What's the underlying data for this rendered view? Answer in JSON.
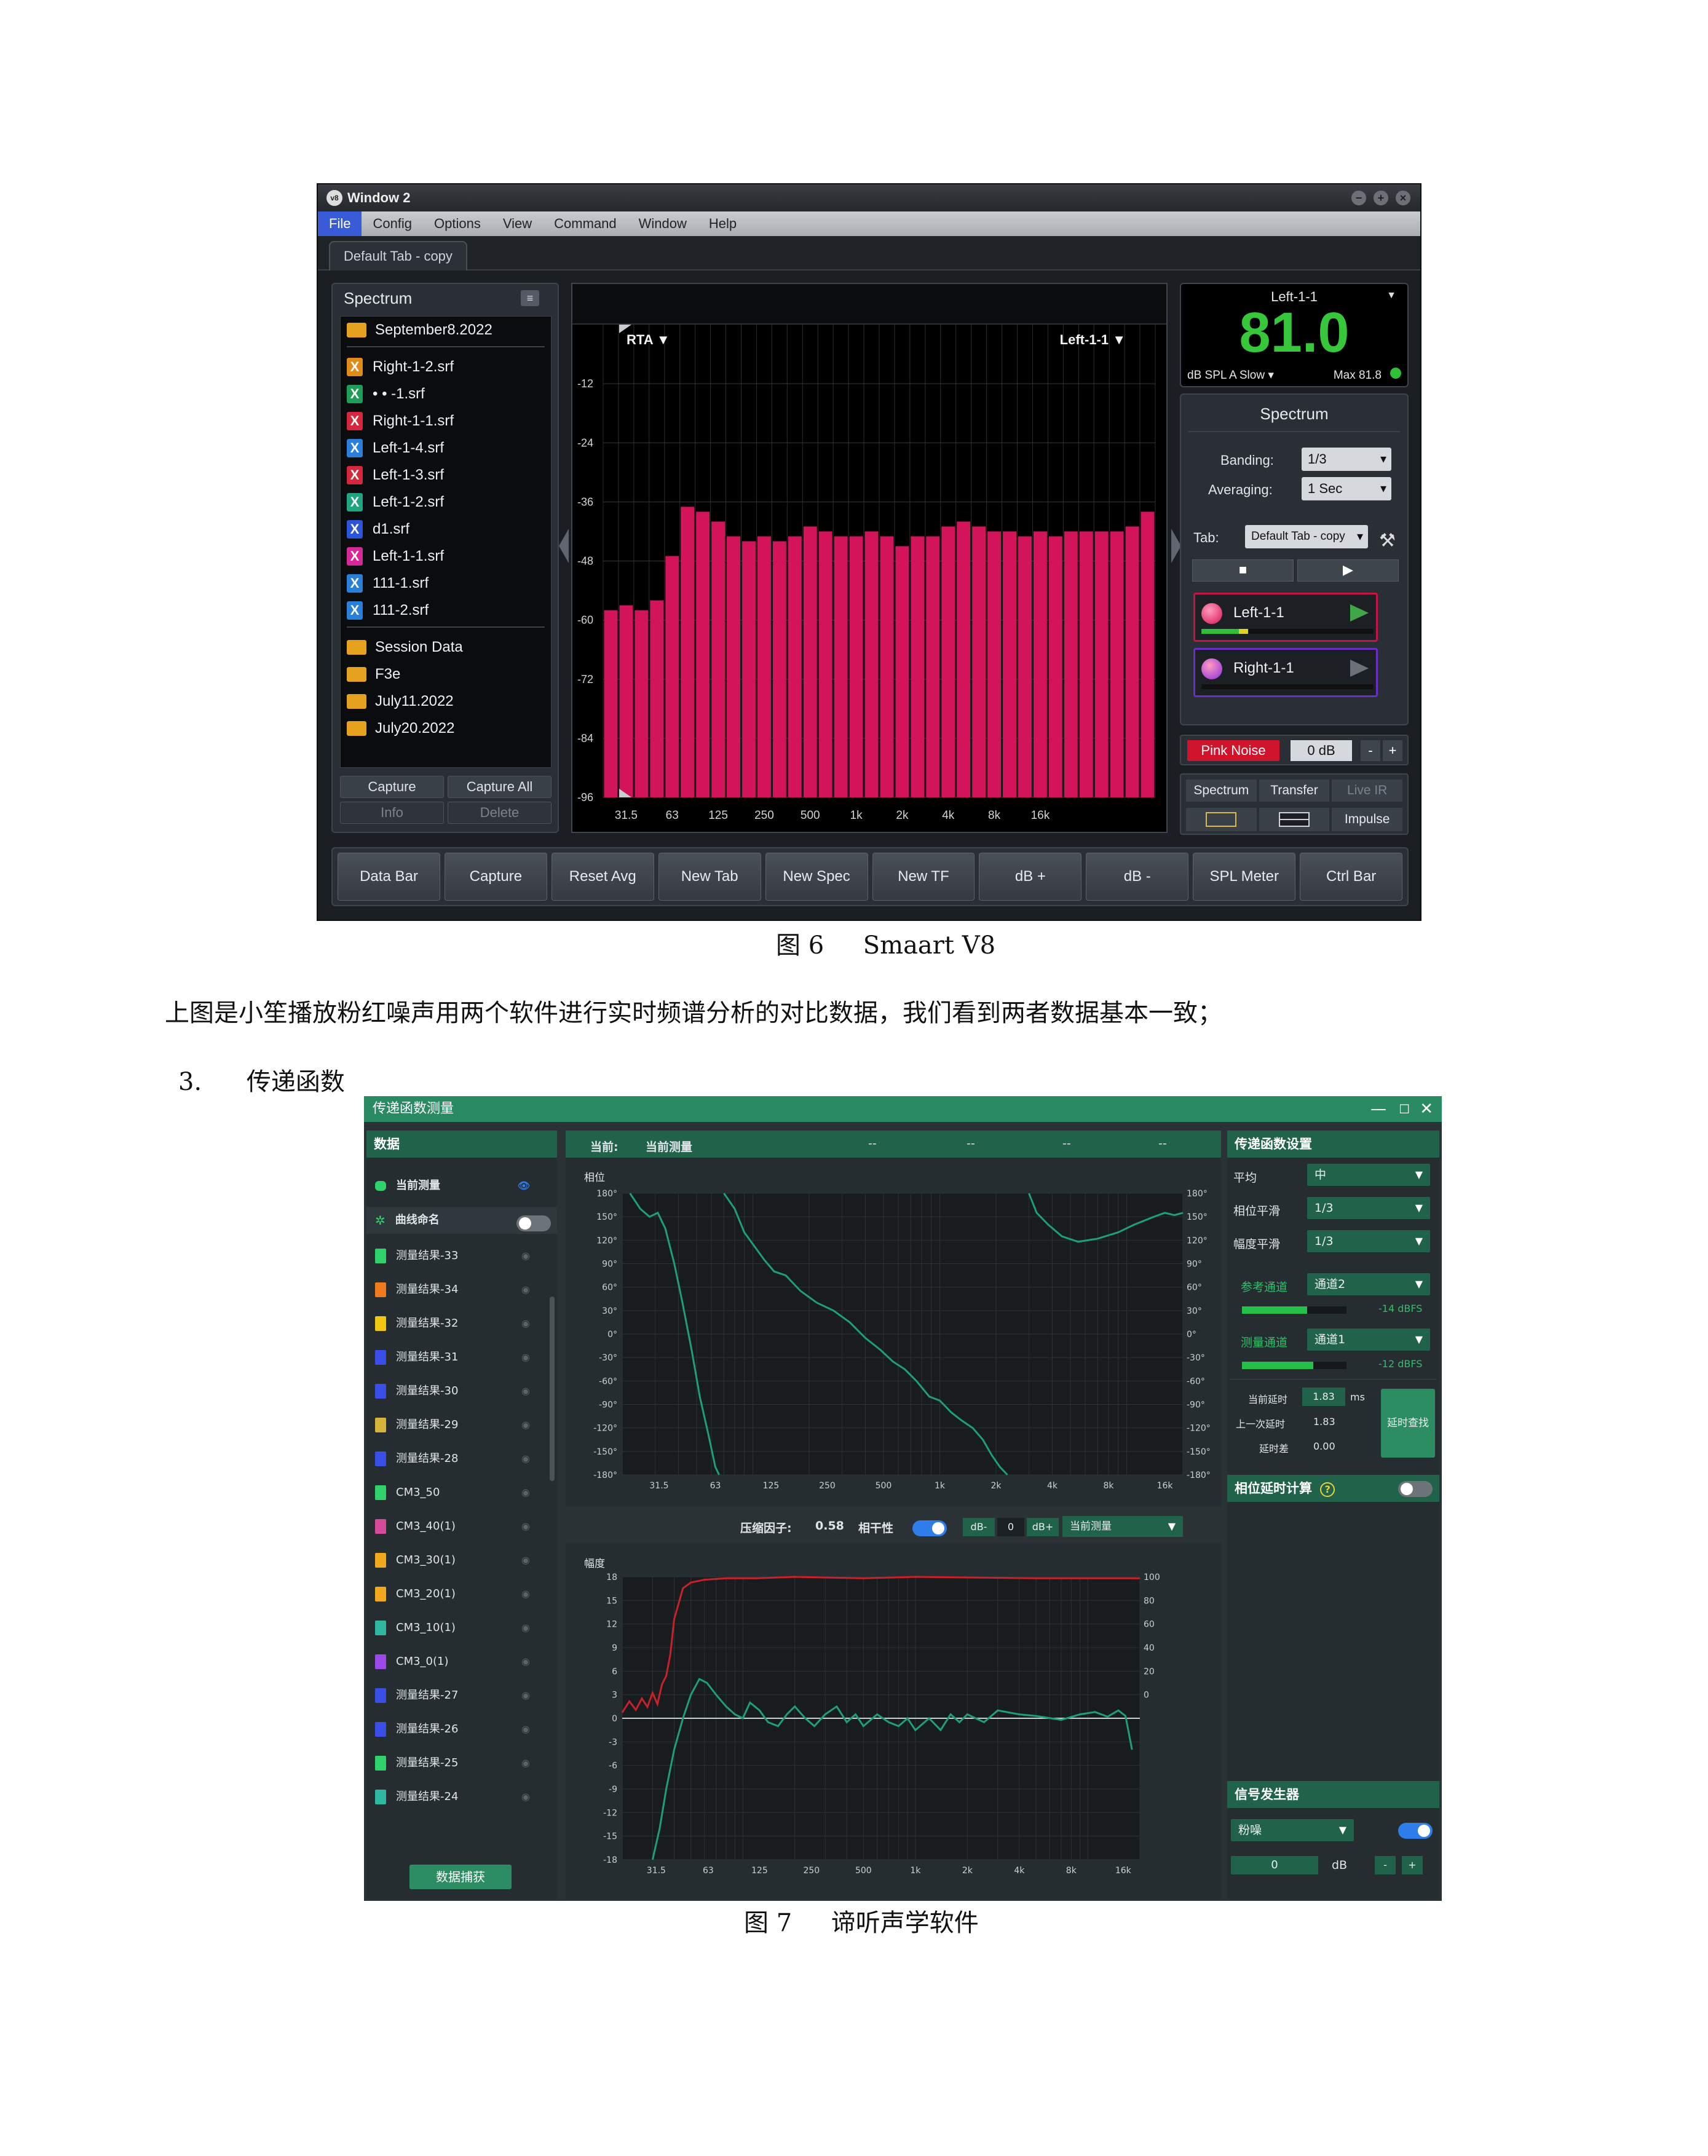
{
  "smaart": {
    "window_title": "Window 2",
    "logo_text": "v8",
    "menu": [
      "File",
      "Config",
      "Options",
      "View",
      "Command",
      "Window",
      "Help"
    ],
    "tab": "Default Tab - copy",
    "left_panel": {
      "title": "Spectrum",
      "root_folder": "September8.2022",
      "files": [
        {
          "name": "Right-1-2.srf",
          "color": "#e08a18"
        },
        {
          "name": "• • -1.srf",
          "color": "#1f9c57"
        },
        {
          "name": "Right-1-1.srf",
          "color": "#d6283c"
        },
        {
          "name": "Left-1-4.srf",
          "color": "#2a7fd8"
        },
        {
          "name": "Left-1-3.srf",
          "color": "#d6283c"
        },
        {
          "name": "Left-1-2.srf",
          "color": "#1fa680"
        },
        {
          "name": "d1.srf",
          "color": "#2a55d8"
        },
        {
          "name": "Left-1-1.srf",
          "color": "#d6289a"
        },
        {
          "name": "111-1.srf",
          "color": "#2a7fd8"
        },
        {
          "name": "111-2.srf",
          "color": "#2a7fd8"
        }
      ],
      "folders": [
        "Session Data",
        "F3e",
        "July11.2022",
        "July20.2022"
      ],
      "buttons": [
        "Capture",
        "Capture All",
        "Info",
        "Delete"
      ]
    },
    "plot": {
      "mode_label": "RTA ▼",
      "source_label": "Left-1-1 ▼"
    },
    "meter": {
      "source": "Left-1-1",
      "value": "81.0",
      "unit": "dB SPL A Slow",
      "max": "Max 81.8"
    },
    "controls": {
      "title": "Spectrum",
      "banding_label": "Banding:",
      "banding_value": "1/3",
      "averaging_label": "Averaging:",
      "averaging_value": "1 Sec",
      "tab_label": "Tab:",
      "tab_value": "Default Tab - copy",
      "stop_icon": "■",
      "play_icon": "▶",
      "channels": [
        {
          "name": "Left-1-1",
          "color": "#d6134e",
          "border": "#c71543",
          "level": 0.27
        },
        {
          "name": "Right-1-1",
          "color": "#8b2be0",
          "border": "#6a2fc8",
          "level": 0.0
        }
      ]
    },
    "generator": {
      "label": "Pink Noise",
      "level": "0 dB",
      "minus": "-",
      "plus": "+"
    },
    "modes": {
      "tabs": [
        "Spectrum",
        "Transfer",
        "Live IR"
      ],
      "options": [
        "",
        "",
        "Impulse"
      ]
    },
    "button_bar": [
      "Data Bar",
      "Capture",
      "Reset Avg",
      "New Tab",
      "New Spec",
      "New TF",
      "dB +",
      "dB -",
      "SPL Meter",
      "Ctrl Bar"
    ],
    "chart_data": {
      "type": "bar",
      "title": "",
      "ylabel": "",
      "ylim": [
        -96,
        0
      ],
      "yticks": [
        -12,
        -24,
        -36,
        -48,
        -60,
        -72,
        -84,
        -96
      ],
      "xticks": [
        "31.5",
        "63",
        "125",
        "250",
        "500",
        "1k",
        "2k",
        "4k",
        "8k",
        "16k"
      ],
      "bar_color": "#d4145a",
      "values": [
        -58,
        -57,
        -58,
        -56,
        -47,
        -37,
        -38,
        -40,
        -43,
        -44,
        -43,
        -44,
        -43,
        -41,
        -42,
        -43,
        -43,
        -42,
        -43,
        -45,
        -43,
        -43,
        -41,
        -40,
        -41,
        -42,
        -42,
        -43,
        -42,
        -43,
        -42,
        -42,
        -42,
        -42,
        -41,
        -38
      ]
    }
  },
  "caption6": {
    "num": "图 6",
    "text": "Smaart V8"
  },
  "paragraph": "上图是小笙播放粉红噪声用两个软件进行实时频谱分析的对比数据，我们看到两者数据基本一致；",
  "section": {
    "num": "3.",
    "title": "传递函数"
  },
  "diting": {
    "window_title": "传递函数测量",
    "window_buttons": [
      "—",
      "☐",
      "✕"
    ],
    "left": {
      "header": "数据",
      "current": "当前测量",
      "naming": "曲线命名",
      "items": [
        {
          "name": "测量结果-33",
          "color": "#2fd36a"
        },
        {
          "name": "测量结果-34",
          "color": "#f07a1e"
        },
        {
          "name": "测量结果-32",
          "color": "#f0c814"
        },
        {
          "name": "测量结果-31",
          "color": "#3a4fe8"
        },
        {
          "name": "测量结果-30",
          "color": "#3a4fe8"
        },
        {
          "name": "测量结果-29",
          "color": "#d6b43a"
        },
        {
          "name": "测量结果-28",
          "color": "#3a4fe8"
        },
        {
          "name": "CM3_50",
          "color": "#2fd36a"
        },
        {
          "name": "CM3_40(1)",
          "color": "#d64a9a"
        },
        {
          "name": "CM3_30(1)",
          "color": "#f0a81e"
        },
        {
          "name": "CM3_20(1)",
          "color": "#f0a81e"
        },
        {
          "name": "CM3_10(1)",
          "color": "#2fb8a0"
        },
        {
          "name": "CM3_0(1)",
          "color": "#9a4ae8"
        },
        {
          "name": "测量结果-27",
          "color": "#3a4fe8"
        },
        {
          "name": "测量结果-26",
          "color": "#3a4fe8"
        },
        {
          "name": "测量结果-25",
          "color": "#2fd36a"
        },
        {
          "name": "测量结果-24",
          "color": "#2fb8a0"
        }
      ],
      "capture_button": "数据捕获"
    },
    "center": {
      "header_label": "当前:",
      "header_value": "当前测量",
      "header_dashes": [
        "--",
        "--",
        "--",
        "--"
      ],
      "phase_title": "相位",
      "compression_label": "压缩因子:",
      "compression_value": "0.58",
      "coherence_label": "相干性",
      "db_minus": "dB-",
      "db_value": "0",
      "db_plus": "dB+",
      "source_select": "当前测量",
      "mag_title": "幅度"
    },
    "right": {
      "settings_header": "传递函数设置",
      "avg_label": "平均",
      "avg_value": "中",
      "phase_smooth_label": "相位平滑",
      "phase_smooth_value": "1/3",
      "mag_smooth_label": "幅度平滑",
      "mag_smooth_value": "1/3",
      "ref_label": "参考通道",
      "ref_value": "通道2",
      "ref_level": "-14 dBFS",
      "meas_label": "测量通道",
      "meas_value": "通道1",
      "meas_level": "-12 dBFS",
      "cur_delay_label": "当前延时",
      "cur_delay_value": "1.83",
      "delay_unit": "ms",
      "prev_delay_label": "上一次延时",
      "prev_delay_value": "1.83",
      "delay_diff_label": "延时差",
      "delay_diff_value": "0.00",
      "find_delay_button": "延时查找",
      "phase_delay_header": "相位延时计算",
      "help_icon": "?",
      "generator_header": "信号发生器",
      "noise_value": "粉噪",
      "gen_level": "0",
      "gen_unit": "dB",
      "minus": "-",
      "plus": "+"
    },
    "chart_data": [
      {
        "type": "line",
        "title": "相位",
        "yticks_left": [
          "180°",
          "150°",
          "120°",
          "90°",
          "60°",
          "30°",
          "0°",
          "-30°",
          "-60°",
          "-90°",
          "-120°",
          "-150°",
          "-180°"
        ],
        "yticks_right": [
          "180°",
          "150°",
          "120°",
          "90°",
          "60°",
          "30°",
          "0°",
          "-30°",
          "-60°",
          "-90°",
          "-120°",
          "-150°",
          "-180°"
        ],
        "ylim": [
          -180,
          180
        ],
        "xticks": [
          "31.5",
          "63",
          "125",
          "250",
          "500",
          "1k",
          "2k",
          "4k",
          "8k",
          "16k"
        ],
        "xlim": [
          20,
          20000
        ],
        "xscale": "log",
        "grid": true,
        "series_color": "#1f9e78",
        "series": [
          {
            "x": [
              22,
              25,
              28,
              31,
              34,
              38,
              42,
              47,
              52,
              58,
              63,
              66
            ],
            "y": [
              185,
              160,
              150,
              155,
              135,
              90,
              40,
              -20,
              -80,
              -130,
              -170,
              -185
            ]
          },
          {
            "x": [
              70,
              80,
              90,
              100,
              115,
              130,
              150,
              180,
              220,
              270,
              330,
              400,
              480,
              560,
              650,
              750,
              880,
              1000,
              1150,
              1300,
              1500,
              1700,
              1900,
              2100,
              2300
            ],
            "y": [
              185,
              160,
              130,
              115,
              95,
              80,
              75,
              55,
              40,
              30,
              15,
              -5,
              -20,
              -35,
              -45,
              -60,
              -80,
              -85,
              -100,
              -110,
              -120,
              -135,
              -155,
              -170,
              -185
            ]
          },
          {
            "x": [
              3000,
              3300,
              3800,
              4500,
              5500,
              7000,
              9000,
              11000,
              14000,
              16000,
              18000,
              20000
            ],
            "y": [
              185,
              155,
              140,
              125,
              118,
              122,
              130,
              140,
              150,
              155,
              152,
              155
            ]
          }
        ]
      },
      {
        "type": "line",
        "title": "幅度",
        "yticks_left": [
          "18",
          "15",
          "12",
          "9",
          "6",
          "3",
          "0",
          "-3",
          "-6",
          "-9",
          "-12",
          "-15",
          "-18"
        ],
        "ylim": [
          -18,
          18
        ],
        "yticks_right": [
          "100",
          "80",
          "60",
          "40",
          "20",
          "0"
        ],
        "y2lim": [
          -100,
          100
        ],
        "xticks": [
          "31.5",
          "63",
          "125",
          "250",
          "500",
          "1k",
          "2k",
          "4k",
          "8k",
          "16k"
        ],
        "xlim": [
          20,
          20000
        ],
        "xscale": "log",
        "grid": true,
        "series": [
          {
            "axis": "right",
            "color": "#c8212a",
            "x": [
              20,
              22,
              24,
              26,
              28,
              30,
              32,
              34,
              36,
              38,
              40,
              45,
              50,
              60,
              80,
              120,
              200,
              500,
              1000,
              5000,
              20000
            ],
            "y": [
              4,
              12,
              6,
              14,
              8,
              18,
              10,
              24,
              30,
              45,
              70,
              92,
              96,
              98,
              99,
              99,
              100,
              99,
              100,
              99,
              99
            ]
          },
          {
            "axis": "left",
            "color": "#1f9e78",
            "x": [
              30,
              33,
              36,
              40,
              45,
              50,
              56,
              62,
              70,
              80,
              90,
              100,
              110,
              125,
              140,
              160,
              180,
              200,
              230,
              260,
              300,
              350,
              400,
              450,
              500,
              600,
              700,
              800,
              900,
              1000,
              1200,
              1400,
              1600,
              1800,
              2000,
              2500,
              3000,
              4000,
              5000,
              7000,
              9000,
              11000,
              13000,
              15000,
              16500,
              18000
            ],
            "y": [
              -18,
              -14,
              -9,
              -4,
              0,
              3,
              5,
              4.5,
              3,
              1.5,
              0.5,
              0,
              2,
              1,
              -0.5,
              -1,
              0.5,
              1.5,
              0,
              -1,
              0.5,
              1.5,
              -0.5,
              0.5,
              -1,
              0.5,
              -0.5,
              -1,
              0,
              -1.5,
              0,
              -1.5,
              0.5,
              -0.5,
              0.5,
              -0.5,
              1,
              0.5,
              0.3,
              -0.2,
              0.5,
              0.8,
              0.2,
              1,
              0.3,
              -4
            ]
          }
        ]
      }
    ]
  },
  "caption7": {
    "num": "图 7",
    "text": "谛听声学软件"
  }
}
